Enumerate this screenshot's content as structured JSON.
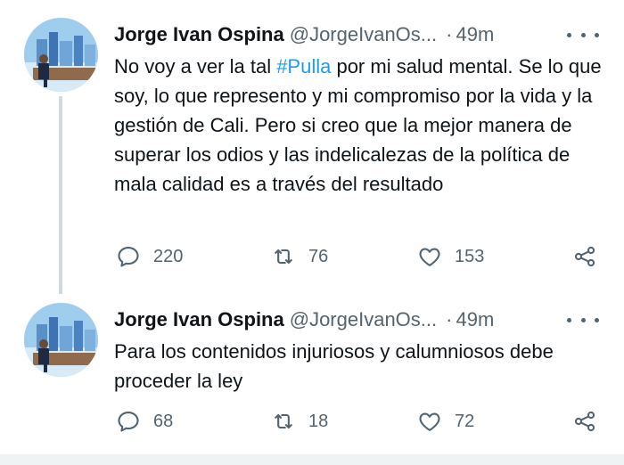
{
  "tweets": [
    {
      "author": {
        "name": "Jorge Ivan Ospina",
        "handle": "@JorgeIvanOs...",
        "time": "49m"
      },
      "text_before": "No voy a ver la tal ",
      "hashtag": "#Pulla",
      "text_after": " por mi salud mental. Se lo que soy, lo que represento y mi compromiso por la vida y la gestión de Cali. Pero si creo que la mejor manera de superar los odios y las indelicalezas de la política de mala calidad es a través del resultado",
      "stats": {
        "replies": "220",
        "retweets": "76",
        "likes": "153"
      }
    },
    {
      "author": {
        "name": "Jorge Ivan Ospina",
        "handle": "@JorgeIvanOs...",
        "time": "49m"
      },
      "text": "Para los contenidos injuriosos y calumniosos debe proceder la ley",
      "stats": {
        "replies": "68",
        "retweets": "18",
        "likes": "72"
      }
    }
  ],
  "icons": {
    "reply": "reply-icon",
    "retweet": "retweet-icon",
    "like": "heart-icon",
    "share": "share-icon",
    "more": "more-options-icon"
  },
  "colors": {
    "text": "#0f1419",
    "secondary": "#536471",
    "hashtag": "#1d9bf0",
    "thread_line": "#cfd9de"
  }
}
